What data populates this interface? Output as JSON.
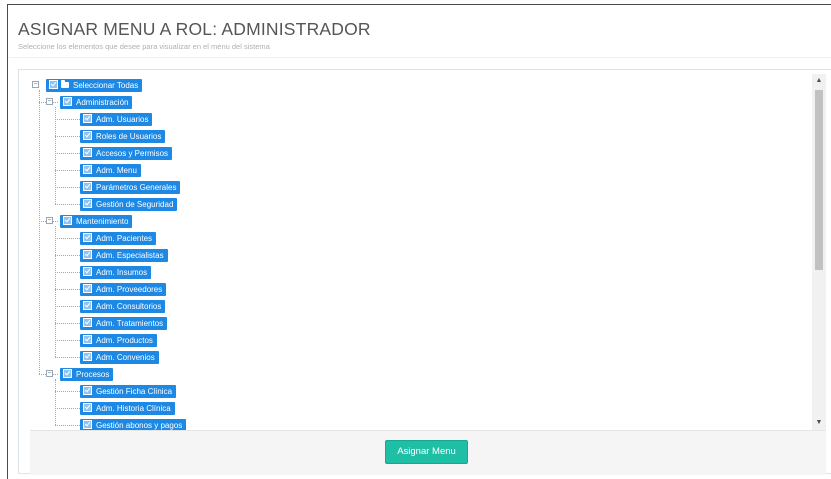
{
  "page": {
    "title": "ASIGNAR MENU A ROL: ADMINISTRADOR",
    "subtitle": "Seleccione los elementos que desee para visualizar en el menu del sistema"
  },
  "tree": {
    "root": {
      "label": "Seleccionar Todas",
      "checked": true,
      "expanded": true
    },
    "groups": [
      {
        "label": "Administración",
        "checked": true,
        "expanded": true,
        "items": [
          {
            "label": "Adm. Usuarios",
            "checked": true
          },
          {
            "label": "Roles de Usuarios",
            "checked": true
          },
          {
            "label": "Accesos y Permisos",
            "checked": true
          },
          {
            "label": "Adm. Menu",
            "checked": true
          },
          {
            "label": "Parámetros Generales",
            "checked": true
          },
          {
            "label": "Gestión de Seguridad",
            "checked": true
          }
        ]
      },
      {
        "label": "Mantenimiento",
        "checked": true,
        "expanded": true,
        "items": [
          {
            "label": "Adm. Pacientes",
            "checked": true
          },
          {
            "label": "Adm. Especialistas",
            "checked": true
          },
          {
            "label": "Adm. Insumos",
            "checked": true
          },
          {
            "label": "Adm. Proveedores",
            "checked": true
          },
          {
            "label": "Adm. Consultorios",
            "checked": true
          },
          {
            "label": "Adm. Tratamientos",
            "checked": true
          },
          {
            "label": "Adm. Productos",
            "checked": true
          },
          {
            "label": "Adm. Convenios",
            "checked": true
          }
        ]
      },
      {
        "label": "Procesos",
        "checked": true,
        "expanded": true,
        "items": [
          {
            "label": "Gestión Ficha Clínica",
            "checked": true
          },
          {
            "label": "Adm. Historia Clínica",
            "checked": true
          },
          {
            "label": "Gestión abonos y pagos",
            "checked": true
          }
        ]
      }
    ]
  },
  "actions": {
    "assign_label": "Asignar Menu"
  },
  "colors": {
    "node_bg": "#1e88e5",
    "button_bg": "#1fbfa6"
  }
}
